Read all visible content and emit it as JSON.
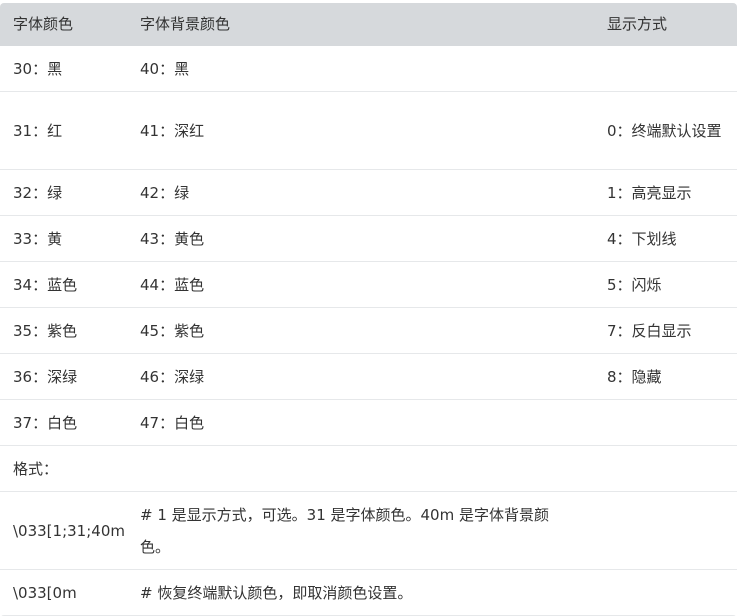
{
  "headers": [
    "字体颜色",
    "字体背景颜色",
    "显示方式"
  ],
  "rows": [
    {
      "fg": "30：黑",
      "bg": "40：黑",
      "mode": ""
    },
    {
      "fg": "31：红",
      "bg": "41：深红",
      "mode": "0：终端默认设置"
    },
    {
      "fg": "32：绿",
      "bg": "42：绿",
      "mode": "1：高亮显示"
    },
    {
      "fg": "33：黄",
      "bg": "43：黄色",
      "mode": "4：下划线"
    },
    {
      "fg": "34：蓝色",
      "bg": "44：蓝色",
      "mode": "5：闪烁"
    },
    {
      "fg": "35：紫色",
      "bg": "45：紫色",
      "mode": "7：反白显示"
    },
    {
      "fg": "36：深绿",
      "bg": "46：深绿",
      "mode": "8：隐藏"
    },
    {
      "fg": "37：白色",
      "bg": "47：白色",
      "mode": ""
    },
    {
      "fg": "格式：",
      "bg": "",
      "mode": ""
    },
    {
      "fg": "\\033[1;31;40m",
      "bg": "# 1 是显示方式，可选。31 是字体颜色。40m 是字体背景颜色。",
      "mode": ""
    },
    {
      "fg": "\\033[0m",
      "bg": "# 恢复终端默认颜色，即取消颜色设置。",
      "mode": ""
    }
  ]
}
